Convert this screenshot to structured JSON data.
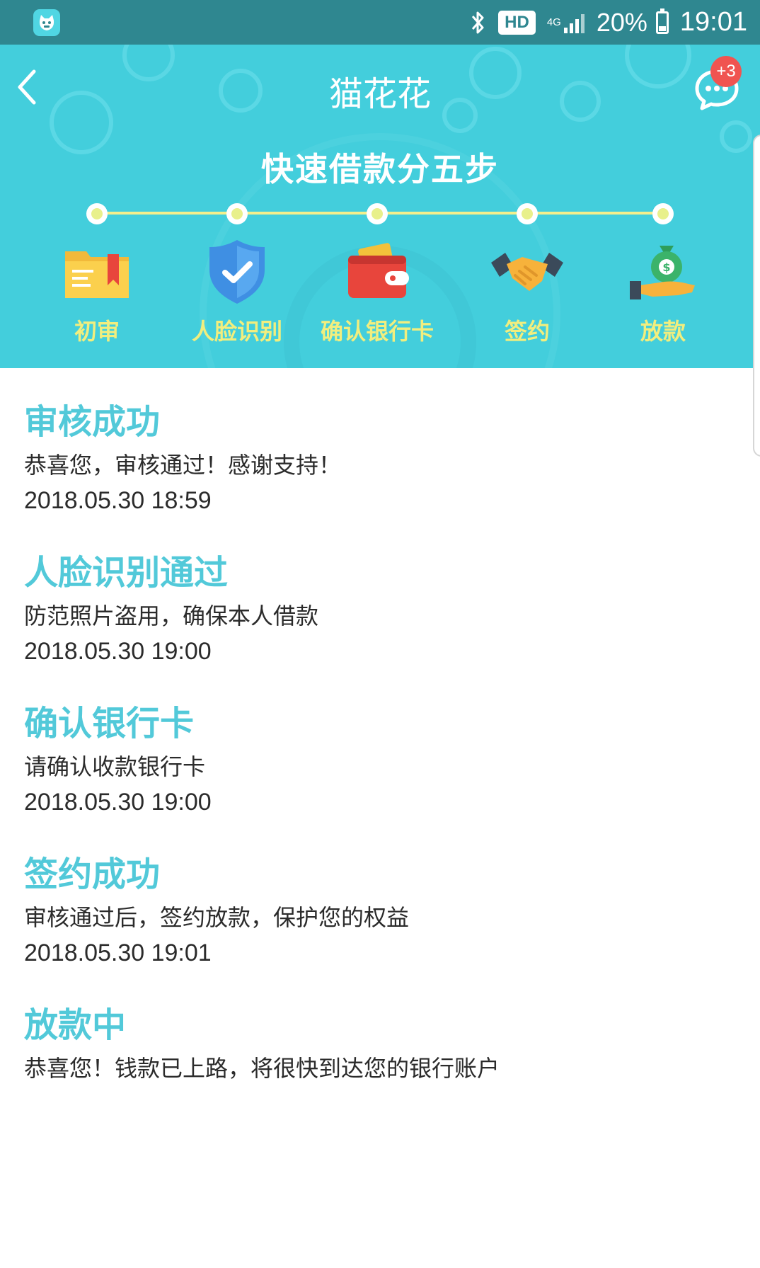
{
  "status_bar": {
    "hd": "HD",
    "network": "4G",
    "battery": "20%",
    "time": "19:01"
  },
  "header": {
    "title": "猫花花",
    "chat_badge": "+3",
    "icons": {
      "back": "chevron-left-icon",
      "chat": "chat-bubble-icon"
    }
  },
  "steps": {
    "heading": "快速借款分五步",
    "items": [
      {
        "label": "初审",
        "icon": "folder-icon"
      },
      {
        "label": "人脸识别",
        "icon": "shield-check-icon"
      },
      {
        "label": "确认银行卡",
        "icon": "wallet-icon"
      },
      {
        "label": "签约",
        "icon": "handshake-icon"
      },
      {
        "label": "放款",
        "icon": "money-bag-hand-icon"
      }
    ]
  },
  "progress": [
    {
      "title": "审核成功",
      "desc": "恭喜您，审核通过！感谢支持！",
      "time": "2018.05.30  18:59"
    },
    {
      "title": "人脸识别通过",
      "desc": "防范照片盗用，确保本人借款",
      "time": "2018.05.30  19:00"
    },
    {
      "title": "确认银行卡",
      "desc": "请确认收款银行卡",
      "time": "2018.05.30  19:00"
    },
    {
      "title": "签约成功",
      "desc": "审核通过后，签约放款，保护您的权益",
      "time": "2018.05.30  19:01"
    },
    {
      "title": "放款中",
      "desc": "恭喜您！钱款已上路，将很快到达您的银行账户",
      "time": ""
    }
  ],
  "colors": {
    "status_bar": "#2f8790",
    "banner": "#43cedc",
    "accent_title": "#52c9d9",
    "step_label": "#f1ee7e",
    "badge": "#f05451"
  }
}
